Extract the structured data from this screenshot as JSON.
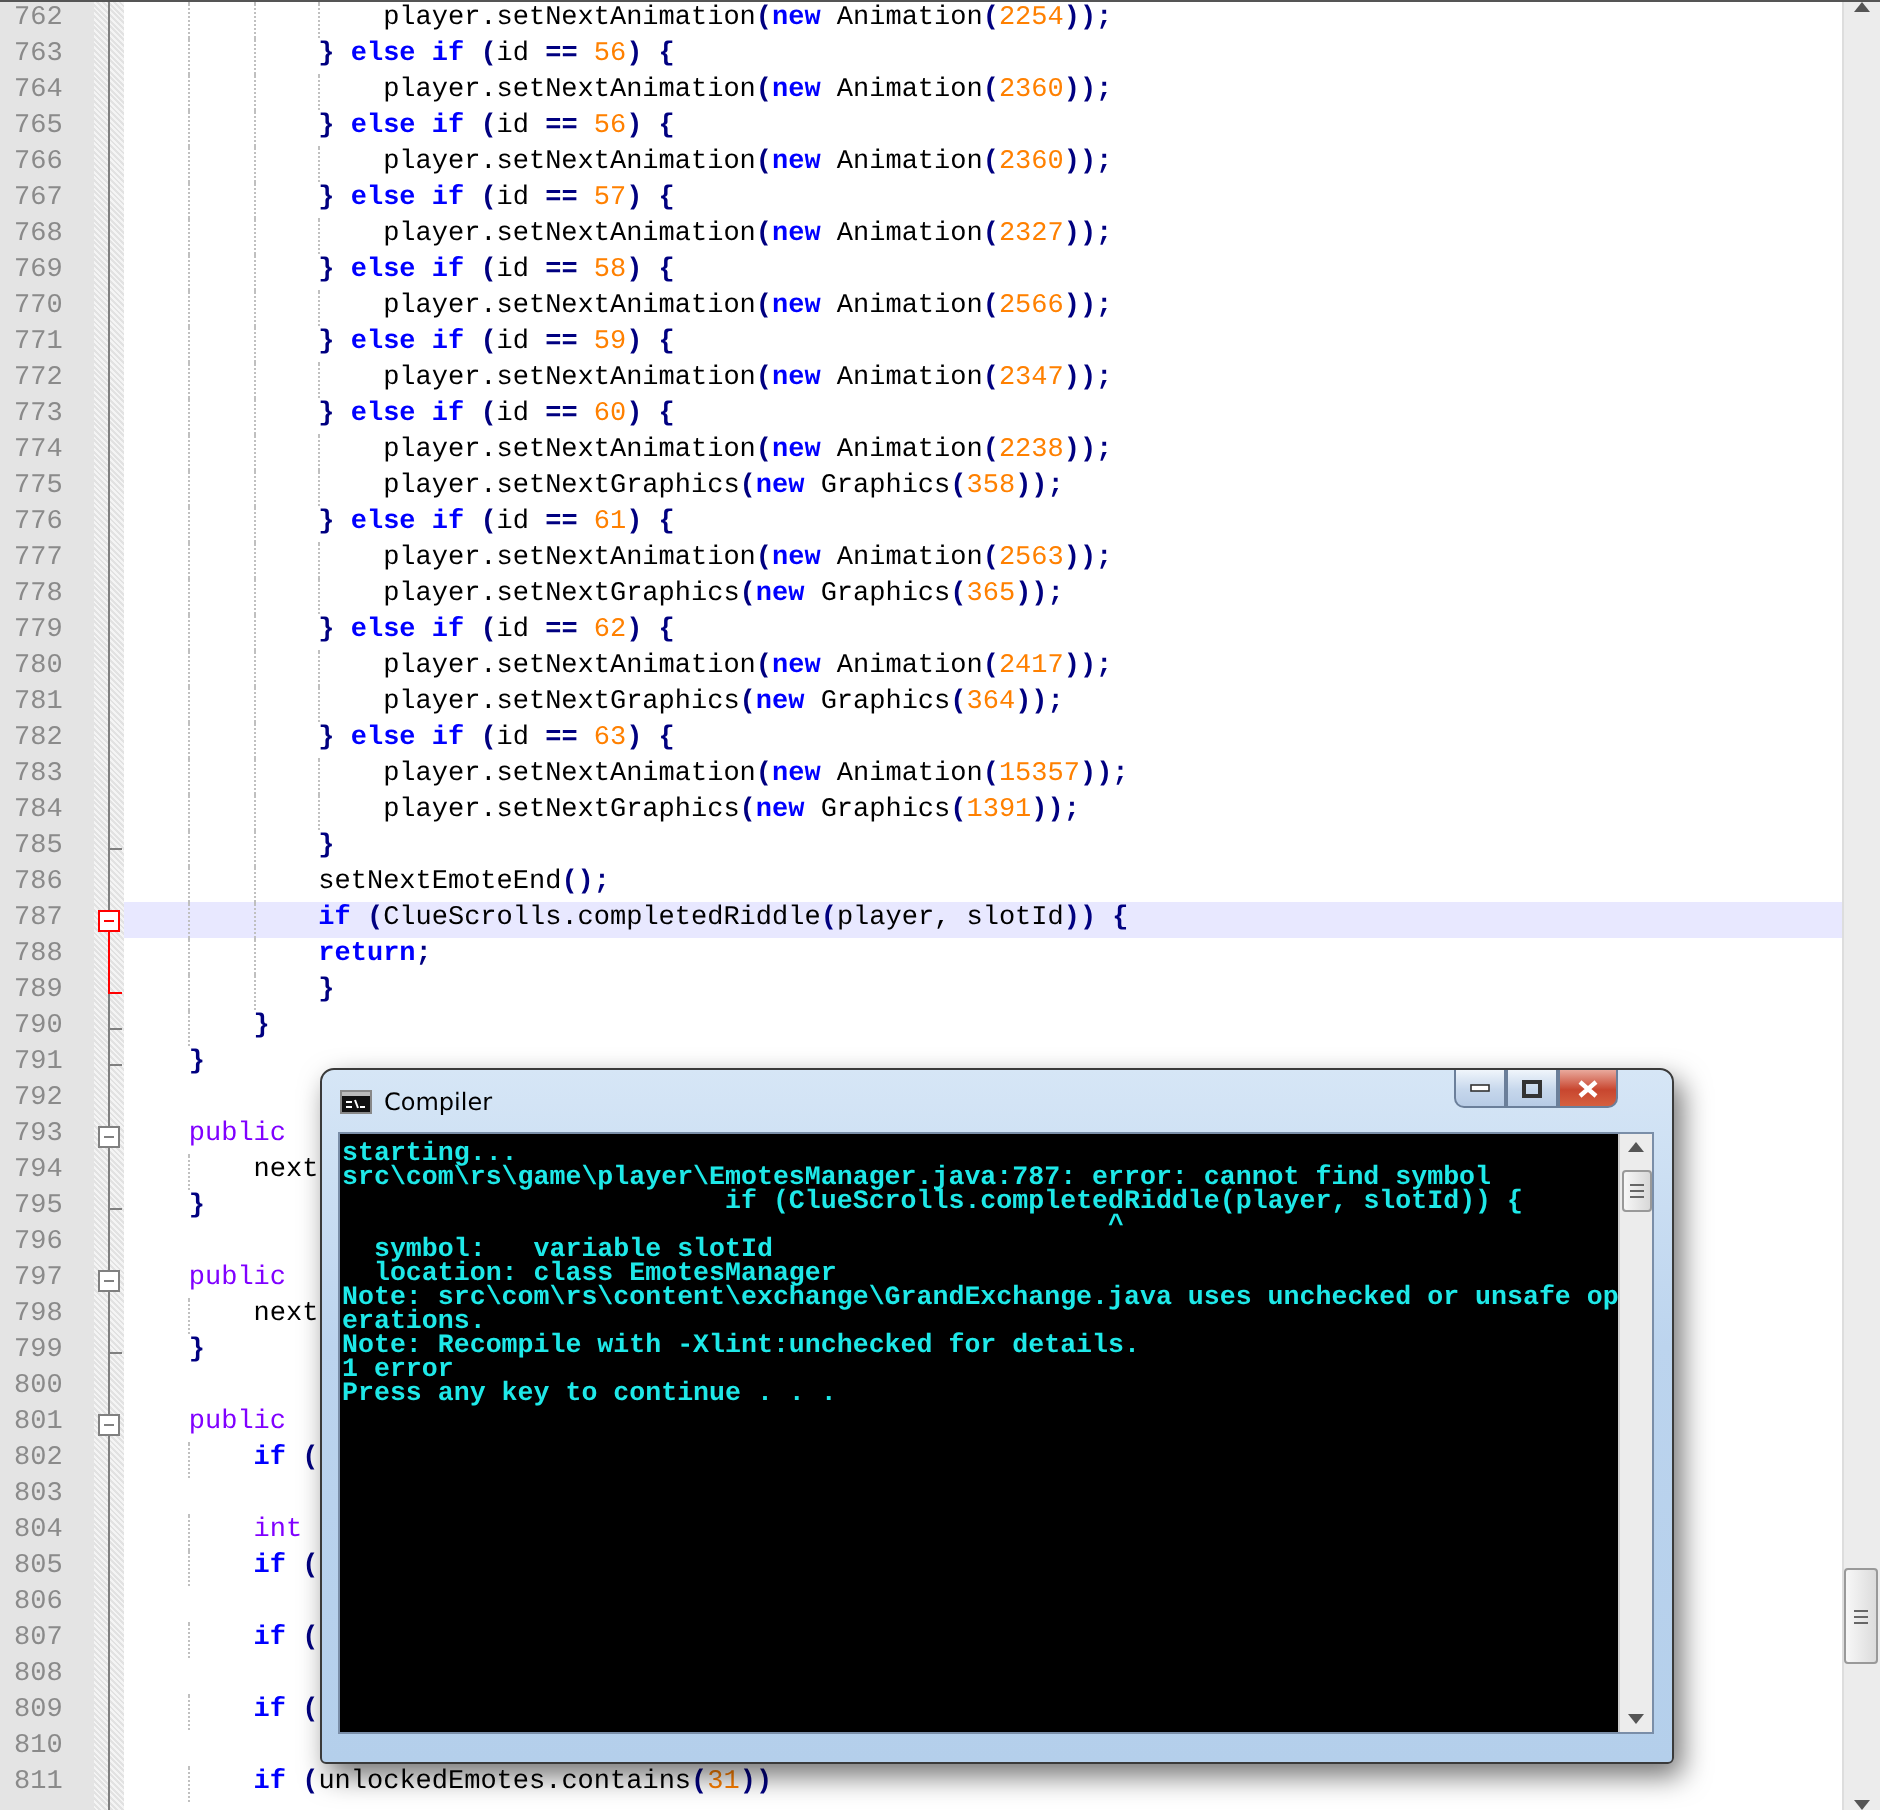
{
  "editor": {
    "lines": [
      {
        "number": "762",
        "current": false,
        "code": [
          {
            "kind": "text",
            "text": "                player.setNextAnimation"
          },
          {
            "kind": "op",
            "text": "("
          },
          {
            "kind": "kw",
            "text": "new"
          },
          {
            "kind": "text",
            "text": " Animation"
          },
          {
            "kind": "op",
            "text": "("
          },
          {
            "kind": "num",
            "text": "2254"
          },
          {
            "kind": "op",
            "text": "));"
          }
        ]
      },
      {
        "number": "763",
        "current": false,
        "code": [
          {
            "kind": "op",
            "text": "            }"
          },
          {
            "kind": "kw",
            "text": " else if"
          },
          {
            "kind": "op",
            "text": " ("
          },
          {
            "kind": "text",
            "text": "id"
          },
          {
            "kind": "op",
            "text": " == "
          },
          {
            "kind": "num",
            "text": "56"
          },
          {
            "kind": "op",
            "text": ") {"
          }
        ]
      },
      {
        "number": "764",
        "current": false,
        "code": [
          {
            "kind": "text",
            "text": "                player.setNextAnimation"
          },
          {
            "kind": "op",
            "text": "("
          },
          {
            "kind": "kw",
            "text": "new"
          },
          {
            "kind": "text",
            "text": " Animation"
          },
          {
            "kind": "op",
            "text": "("
          },
          {
            "kind": "num",
            "text": "2360"
          },
          {
            "kind": "op",
            "text": "));"
          }
        ]
      },
      {
        "number": "765",
        "current": false,
        "code": [
          {
            "kind": "op",
            "text": "            }"
          },
          {
            "kind": "kw",
            "text": " else if"
          },
          {
            "kind": "op",
            "text": " ("
          },
          {
            "kind": "text",
            "text": "id"
          },
          {
            "kind": "op",
            "text": " == "
          },
          {
            "kind": "num",
            "text": "56"
          },
          {
            "kind": "op",
            "text": ") {"
          }
        ]
      },
      {
        "number": "766",
        "current": false,
        "code": [
          {
            "kind": "text",
            "text": "                player.setNextAnimation"
          },
          {
            "kind": "op",
            "text": "("
          },
          {
            "kind": "kw",
            "text": "new"
          },
          {
            "kind": "text",
            "text": " Animation"
          },
          {
            "kind": "op",
            "text": "("
          },
          {
            "kind": "num",
            "text": "2360"
          },
          {
            "kind": "op",
            "text": "));"
          }
        ]
      },
      {
        "number": "767",
        "current": false,
        "code": [
          {
            "kind": "op",
            "text": "            }"
          },
          {
            "kind": "kw",
            "text": " else if"
          },
          {
            "kind": "op",
            "text": " ("
          },
          {
            "kind": "text",
            "text": "id"
          },
          {
            "kind": "op",
            "text": " == "
          },
          {
            "kind": "num",
            "text": "57"
          },
          {
            "kind": "op",
            "text": ") {"
          }
        ]
      },
      {
        "number": "768",
        "current": false,
        "code": [
          {
            "kind": "text",
            "text": "                player.setNextAnimation"
          },
          {
            "kind": "op",
            "text": "("
          },
          {
            "kind": "kw",
            "text": "new"
          },
          {
            "kind": "text",
            "text": " Animation"
          },
          {
            "kind": "op",
            "text": "("
          },
          {
            "kind": "num",
            "text": "2327"
          },
          {
            "kind": "op",
            "text": "));"
          }
        ]
      },
      {
        "number": "769",
        "current": false,
        "code": [
          {
            "kind": "op",
            "text": "            }"
          },
          {
            "kind": "kw",
            "text": " else if"
          },
          {
            "kind": "op",
            "text": " ("
          },
          {
            "kind": "text",
            "text": "id"
          },
          {
            "kind": "op",
            "text": " == "
          },
          {
            "kind": "num",
            "text": "58"
          },
          {
            "kind": "op",
            "text": ") {"
          }
        ]
      },
      {
        "number": "770",
        "current": false,
        "code": [
          {
            "kind": "text",
            "text": "                player.setNextAnimation"
          },
          {
            "kind": "op",
            "text": "("
          },
          {
            "kind": "kw",
            "text": "new"
          },
          {
            "kind": "text",
            "text": " Animation"
          },
          {
            "kind": "op",
            "text": "("
          },
          {
            "kind": "num",
            "text": "2566"
          },
          {
            "kind": "op",
            "text": "));"
          }
        ]
      },
      {
        "number": "771",
        "current": false,
        "code": [
          {
            "kind": "op",
            "text": "            }"
          },
          {
            "kind": "kw",
            "text": " else if"
          },
          {
            "kind": "op",
            "text": " ("
          },
          {
            "kind": "text",
            "text": "id"
          },
          {
            "kind": "op",
            "text": " == "
          },
          {
            "kind": "num",
            "text": "59"
          },
          {
            "kind": "op",
            "text": ") {"
          }
        ]
      },
      {
        "number": "772",
        "current": false,
        "code": [
          {
            "kind": "text",
            "text": "                player.setNextAnimation"
          },
          {
            "kind": "op",
            "text": "("
          },
          {
            "kind": "kw",
            "text": "new"
          },
          {
            "kind": "text",
            "text": " Animation"
          },
          {
            "kind": "op",
            "text": "("
          },
          {
            "kind": "num",
            "text": "2347"
          },
          {
            "kind": "op",
            "text": "));"
          }
        ]
      },
      {
        "number": "773",
        "current": false,
        "code": [
          {
            "kind": "op",
            "text": "            }"
          },
          {
            "kind": "kw",
            "text": " else if"
          },
          {
            "kind": "op",
            "text": " ("
          },
          {
            "kind": "text",
            "text": "id"
          },
          {
            "kind": "op",
            "text": " == "
          },
          {
            "kind": "num",
            "text": "60"
          },
          {
            "kind": "op",
            "text": ") {"
          }
        ]
      },
      {
        "number": "774",
        "current": false,
        "code": [
          {
            "kind": "text",
            "text": "                player.setNextAnimation"
          },
          {
            "kind": "op",
            "text": "("
          },
          {
            "kind": "kw",
            "text": "new"
          },
          {
            "kind": "text",
            "text": " Animation"
          },
          {
            "kind": "op",
            "text": "("
          },
          {
            "kind": "num",
            "text": "2238"
          },
          {
            "kind": "op",
            "text": "));"
          }
        ]
      },
      {
        "number": "775",
        "current": false,
        "code": [
          {
            "kind": "text",
            "text": "                player.setNextGraphics"
          },
          {
            "kind": "op",
            "text": "("
          },
          {
            "kind": "kw",
            "text": "new"
          },
          {
            "kind": "text",
            "text": " Graphics"
          },
          {
            "kind": "op",
            "text": "("
          },
          {
            "kind": "num",
            "text": "358"
          },
          {
            "kind": "op",
            "text": "));"
          }
        ]
      },
      {
        "number": "776",
        "current": false,
        "code": [
          {
            "kind": "op",
            "text": "            }"
          },
          {
            "kind": "kw",
            "text": " else if"
          },
          {
            "kind": "op",
            "text": " ("
          },
          {
            "kind": "text",
            "text": "id"
          },
          {
            "kind": "op",
            "text": " == "
          },
          {
            "kind": "num",
            "text": "61"
          },
          {
            "kind": "op",
            "text": ") {"
          }
        ]
      },
      {
        "number": "777",
        "current": false,
        "code": [
          {
            "kind": "text",
            "text": "                player.setNextAnimation"
          },
          {
            "kind": "op",
            "text": "("
          },
          {
            "kind": "kw",
            "text": "new"
          },
          {
            "kind": "text",
            "text": " Animation"
          },
          {
            "kind": "op",
            "text": "("
          },
          {
            "kind": "num",
            "text": "2563"
          },
          {
            "kind": "op",
            "text": "));"
          }
        ]
      },
      {
        "number": "778",
        "current": false,
        "code": [
          {
            "kind": "text",
            "text": "                player.setNextGraphics"
          },
          {
            "kind": "op",
            "text": "("
          },
          {
            "kind": "kw",
            "text": "new"
          },
          {
            "kind": "text",
            "text": " Graphics"
          },
          {
            "kind": "op",
            "text": "("
          },
          {
            "kind": "num",
            "text": "365"
          },
          {
            "kind": "op",
            "text": "));"
          }
        ]
      },
      {
        "number": "779",
        "current": false,
        "code": [
          {
            "kind": "op",
            "text": "            }"
          },
          {
            "kind": "kw",
            "text": " else if"
          },
          {
            "kind": "op",
            "text": " ("
          },
          {
            "kind": "text",
            "text": "id"
          },
          {
            "kind": "op",
            "text": " == "
          },
          {
            "kind": "num",
            "text": "62"
          },
          {
            "kind": "op",
            "text": ") {"
          }
        ]
      },
      {
        "number": "780",
        "current": false,
        "code": [
          {
            "kind": "text",
            "text": "                player.setNextAnimation"
          },
          {
            "kind": "op",
            "text": "("
          },
          {
            "kind": "kw",
            "text": "new"
          },
          {
            "kind": "text",
            "text": " Animation"
          },
          {
            "kind": "op",
            "text": "("
          },
          {
            "kind": "num",
            "text": "2417"
          },
          {
            "kind": "op",
            "text": "));"
          }
        ]
      },
      {
        "number": "781",
        "current": false,
        "code": [
          {
            "kind": "text",
            "text": "                player.setNextGraphics"
          },
          {
            "kind": "op",
            "text": "("
          },
          {
            "kind": "kw",
            "text": "new"
          },
          {
            "kind": "text",
            "text": " Graphics"
          },
          {
            "kind": "op",
            "text": "("
          },
          {
            "kind": "num",
            "text": "364"
          },
          {
            "kind": "op",
            "text": "));"
          }
        ]
      },
      {
        "number": "782",
        "current": false,
        "code": [
          {
            "kind": "op",
            "text": "            }"
          },
          {
            "kind": "kw",
            "text": " else if"
          },
          {
            "kind": "op",
            "text": " ("
          },
          {
            "kind": "text",
            "text": "id"
          },
          {
            "kind": "op",
            "text": " == "
          },
          {
            "kind": "num",
            "text": "63"
          },
          {
            "kind": "op",
            "text": ") {"
          }
        ]
      },
      {
        "number": "783",
        "current": false,
        "code": [
          {
            "kind": "text",
            "text": "                player.setNextAnimation"
          },
          {
            "kind": "op",
            "text": "("
          },
          {
            "kind": "kw",
            "text": "new"
          },
          {
            "kind": "text",
            "text": " Animation"
          },
          {
            "kind": "op",
            "text": "("
          },
          {
            "kind": "num",
            "text": "15357"
          },
          {
            "kind": "op",
            "text": "));"
          }
        ]
      },
      {
        "number": "784",
        "current": false,
        "code": [
          {
            "kind": "text",
            "text": "                player.setNextGraphics"
          },
          {
            "kind": "op",
            "text": "("
          },
          {
            "kind": "kw",
            "text": "new"
          },
          {
            "kind": "text",
            "text": " Graphics"
          },
          {
            "kind": "op",
            "text": "("
          },
          {
            "kind": "num",
            "text": "1391"
          },
          {
            "kind": "op",
            "text": "));"
          }
        ]
      },
      {
        "number": "785",
        "current": false,
        "fold": {
          "kind": "end"
        },
        "code": [
          {
            "kind": "op",
            "text": "            }"
          }
        ]
      },
      {
        "number": "786",
        "current": false,
        "code": [
          {
            "kind": "text",
            "text": "            setNextEmoteEnd"
          },
          {
            "kind": "op",
            "text": "();"
          }
        ]
      },
      {
        "number": "787",
        "current": true,
        "fold": {
          "kind": "active-start"
        },
        "code": [
          {
            "kind": "kw",
            "text": "            if"
          },
          {
            "kind": "op",
            "text": " ("
          },
          {
            "kind": "text",
            "text": "ClueScrolls.completedRiddle"
          },
          {
            "kind": "op",
            "text": "("
          },
          {
            "kind": "text",
            "text": "player, slotId"
          },
          {
            "kind": "op",
            "text": ")) {"
          }
        ]
      },
      {
        "number": "788",
        "current": false,
        "fold": {
          "kind": "active"
        },
        "code": [
          {
            "kind": "kw",
            "text": "            return"
          },
          {
            "kind": "op",
            "text": ";"
          }
        ]
      },
      {
        "number": "789",
        "current": false,
        "fold": {
          "kind": "active-end"
        },
        "code": [
          {
            "kind": "op",
            "text": "            }"
          }
        ]
      },
      {
        "number": "790",
        "current": false,
        "fold": {
          "kind": "end"
        },
        "code": [
          {
            "kind": "op",
            "text": "        }"
          }
        ]
      },
      {
        "number": "791",
        "current": false,
        "fold": {
          "kind": "end"
        },
        "code": [
          {
            "kind": "op",
            "text": "    }"
          }
        ]
      },
      {
        "number": "792",
        "current": false
      },
      {
        "number": "793",
        "current": false,
        "fold": {
          "kind": "start"
        },
        "code": [
          {
            "kind": "type",
            "text": "    public"
          }
        ]
      },
      {
        "number": "794",
        "current": false,
        "code": [
          {
            "kind": "text",
            "text": "        next"
          }
        ]
      },
      {
        "number": "795",
        "current": false,
        "fold": {
          "kind": "end"
        },
        "code": [
          {
            "kind": "op",
            "text": "    }"
          }
        ]
      },
      {
        "number": "796",
        "current": false
      },
      {
        "number": "797",
        "current": false,
        "fold": {
          "kind": "start"
        },
        "code": [
          {
            "kind": "type",
            "text": "    public"
          }
        ]
      },
      {
        "number": "798",
        "current": false,
        "code": [
          {
            "kind": "text",
            "text": "        next"
          }
        ]
      },
      {
        "number": "799",
        "current": false,
        "fold": {
          "kind": "end"
        },
        "code": [
          {
            "kind": "op",
            "text": "    }"
          }
        ]
      },
      {
        "number": "800",
        "current": false
      },
      {
        "number": "801",
        "current": false,
        "fold": {
          "kind": "start"
        },
        "code": [
          {
            "kind": "type",
            "text": "    public"
          }
        ]
      },
      {
        "number": "802",
        "current": false,
        "code": [
          {
            "kind": "kw",
            "text": "        if"
          },
          {
            "kind": "op",
            "text": " ("
          }
        ]
      },
      {
        "number": "803",
        "current": false
      },
      {
        "number": "804",
        "current": false,
        "code": [
          {
            "kind": "type",
            "text": "        int"
          }
        ]
      },
      {
        "number": "805",
        "current": false,
        "code": [
          {
            "kind": "kw",
            "text": "        if"
          },
          {
            "kind": "op",
            "text": " ("
          }
        ]
      },
      {
        "number": "806",
        "current": false
      },
      {
        "number": "807",
        "current": false,
        "code": [
          {
            "kind": "kw",
            "text": "        if"
          },
          {
            "kind": "op",
            "text": " ("
          }
        ]
      },
      {
        "number": "808",
        "current": false
      },
      {
        "number": "809",
        "current": false,
        "code": [
          {
            "kind": "kw",
            "text": "        if"
          },
          {
            "kind": "op",
            "text": " ("
          }
        ]
      },
      {
        "number": "810",
        "current": false
      },
      {
        "number": "811",
        "current": false,
        "code": [
          {
            "kind": "kw",
            "text": "        if"
          },
          {
            "kind": "op",
            "text": " ("
          },
          {
            "kind": "text",
            "text": "unlockedEmotes.contains"
          },
          {
            "kind": "op",
            "text": "("
          },
          {
            "kind": "num",
            "text": "31"
          },
          {
            "kind": "op",
            "text": "))"
          }
        ]
      }
    ]
  },
  "compiler": {
    "title": "Compiler",
    "console_lines": [
      "starting...",
      "src\\com\\rs\\game\\player\\EmotesManager.java:787: error: cannot find symbol",
      "                        if (ClueScrolls.completedRiddle(player, slotId)) {",
      "                                                ^",
      "  symbol:   variable slotId",
      "  location: class EmotesManager",
      "Note: src\\com\\rs\\content\\exchange\\GrandExchange.java uses unchecked or unsafe op",
      "erations.",
      "Note: Recompile with -Xlint:unchecked for details.",
      "1 error",
      "Press any key to continue . . ."
    ]
  }
}
